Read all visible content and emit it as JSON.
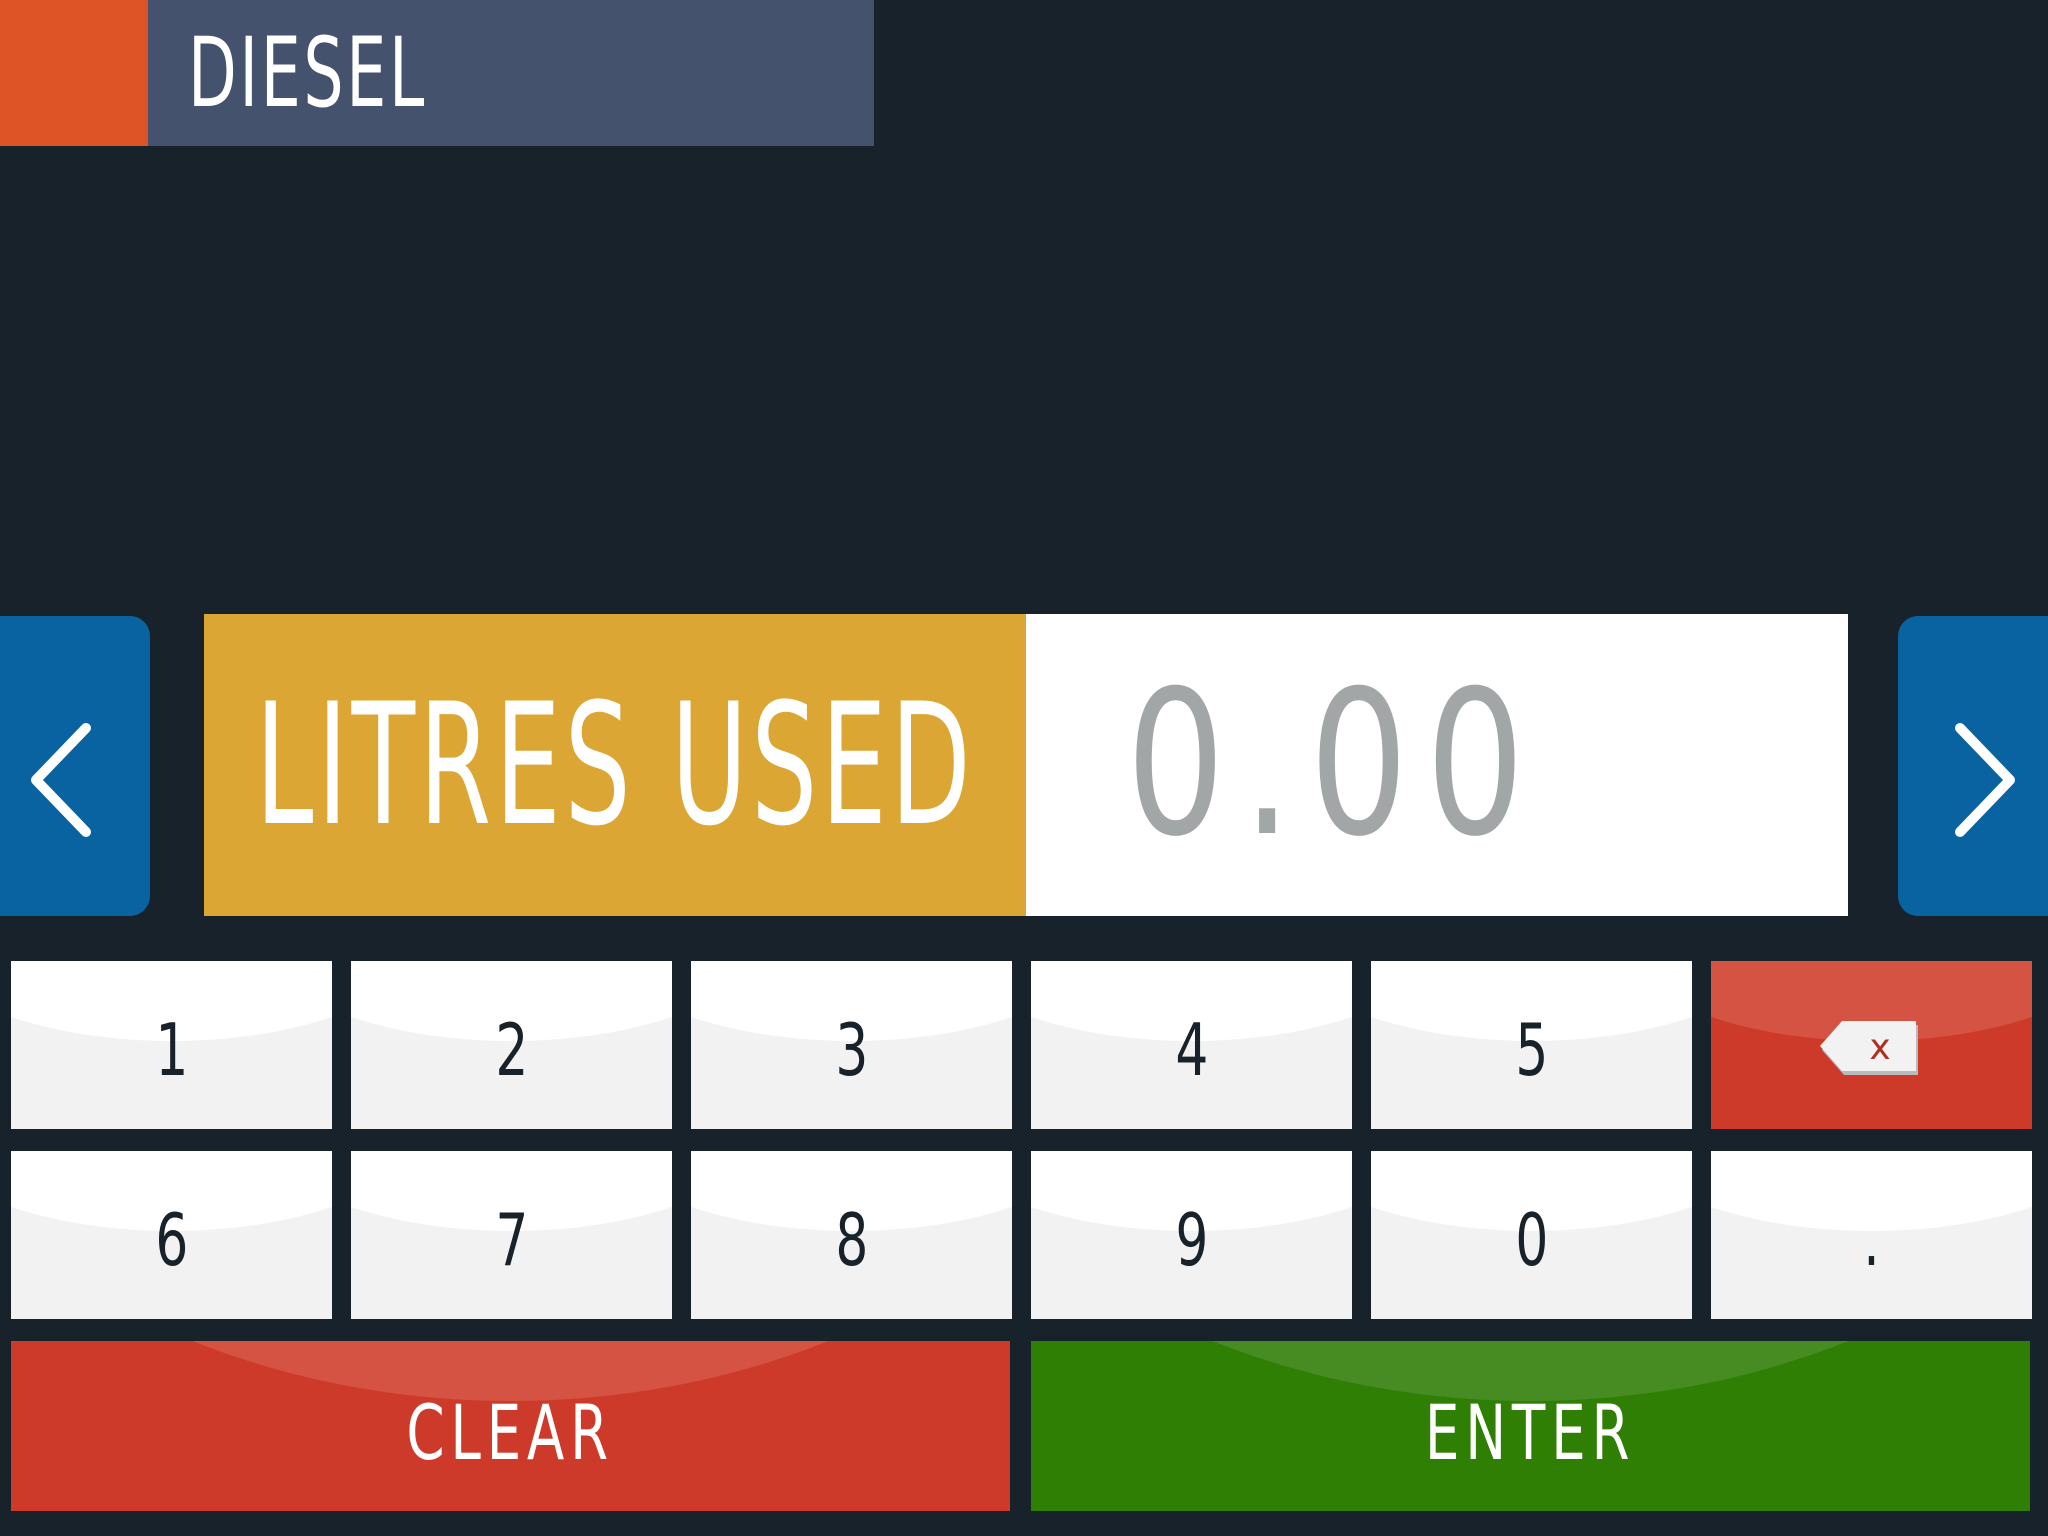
{
  "header": {
    "title": "DIESEL"
  },
  "nav": {
    "prev_icon": "chevron-left-icon",
    "next_icon": "chevron-right-icon"
  },
  "field": {
    "label": "LITRES USED",
    "value": "0.00"
  },
  "keypad": {
    "row1": [
      "1",
      "2",
      "3",
      "4",
      "5"
    ],
    "row2": [
      "6",
      "7",
      "8",
      "9",
      "0",
      "."
    ],
    "backspace_icon": "backspace-icon",
    "backspace_glyph": "x",
    "clear_label": "CLEAR",
    "enter_label": "ENTER"
  },
  "colors": {
    "background": "#18222b",
    "header_accent": "#de5426",
    "header_bar": "#45526e",
    "label_gold": "#dba634",
    "nav_blue": "#0963a0",
    "danger_red": "#cd3a29",
    "enter_green": "#2f7f04"
  }
}
